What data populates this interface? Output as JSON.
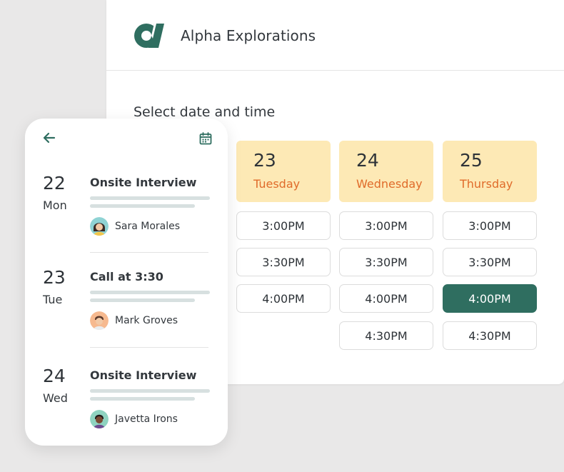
{
  "panel": {
    "brand_name": "Alpha Explorations",
    "section_title": "Select date and time",
    "days": [
      {
        "day_num": "23",
        "weekday": "Tuesday"
      },
      {
        "day_num": "24",
        "weekday": "Wednesday"
      },
      {
        "day_num": "25",
        "weekday": "Thursday"
      }
    ],
    "slots": {
      "tuesday": [
        "3:00PM",
        "3:30PM",
        "4:00PM"
      ],
      "wednesday": [
        "3:00PM",
        "3:30PM",
        "4:00PM",
        "4:30PM"
      ],
      "thursday": [
        "3:00PM",
        "3:30PM",
        "4:00PM",
        "4:30PM"
      ]
    },
    "selected_slot": {
      "day": "Thursday",
      "time": "4:00PM"
    }
  },
  "mobile": {
    "items": [
      {
        "day_num": "22",
        "weekday": "Mon",
        "title": "Onsite Interview",
        "person": "Sara Morales"
      },
      {
        "day_num": "23",
        "weekday": "Tue",
        "title": "Call at 3:30",
        "person": "Mark Groves"
      },
      {
        "day_num": "24",
        "weekday": "Wed",
        "title": "Onsite Interview",
        "person": "Javetta Irons"
      }
    ]
  },
  "colors": {
    "accent": "#2f6e60",
    "day_card_bg": "#fde9b5",
    "weekday_text": "#e06b2a",
    "background": "#e9e8e8"
  },
  "icons": {
    "brand": "alpha-logo-icon",
    "back": "arrow-left-icon",
    "calendar": "calendar-icon"
  }
}
